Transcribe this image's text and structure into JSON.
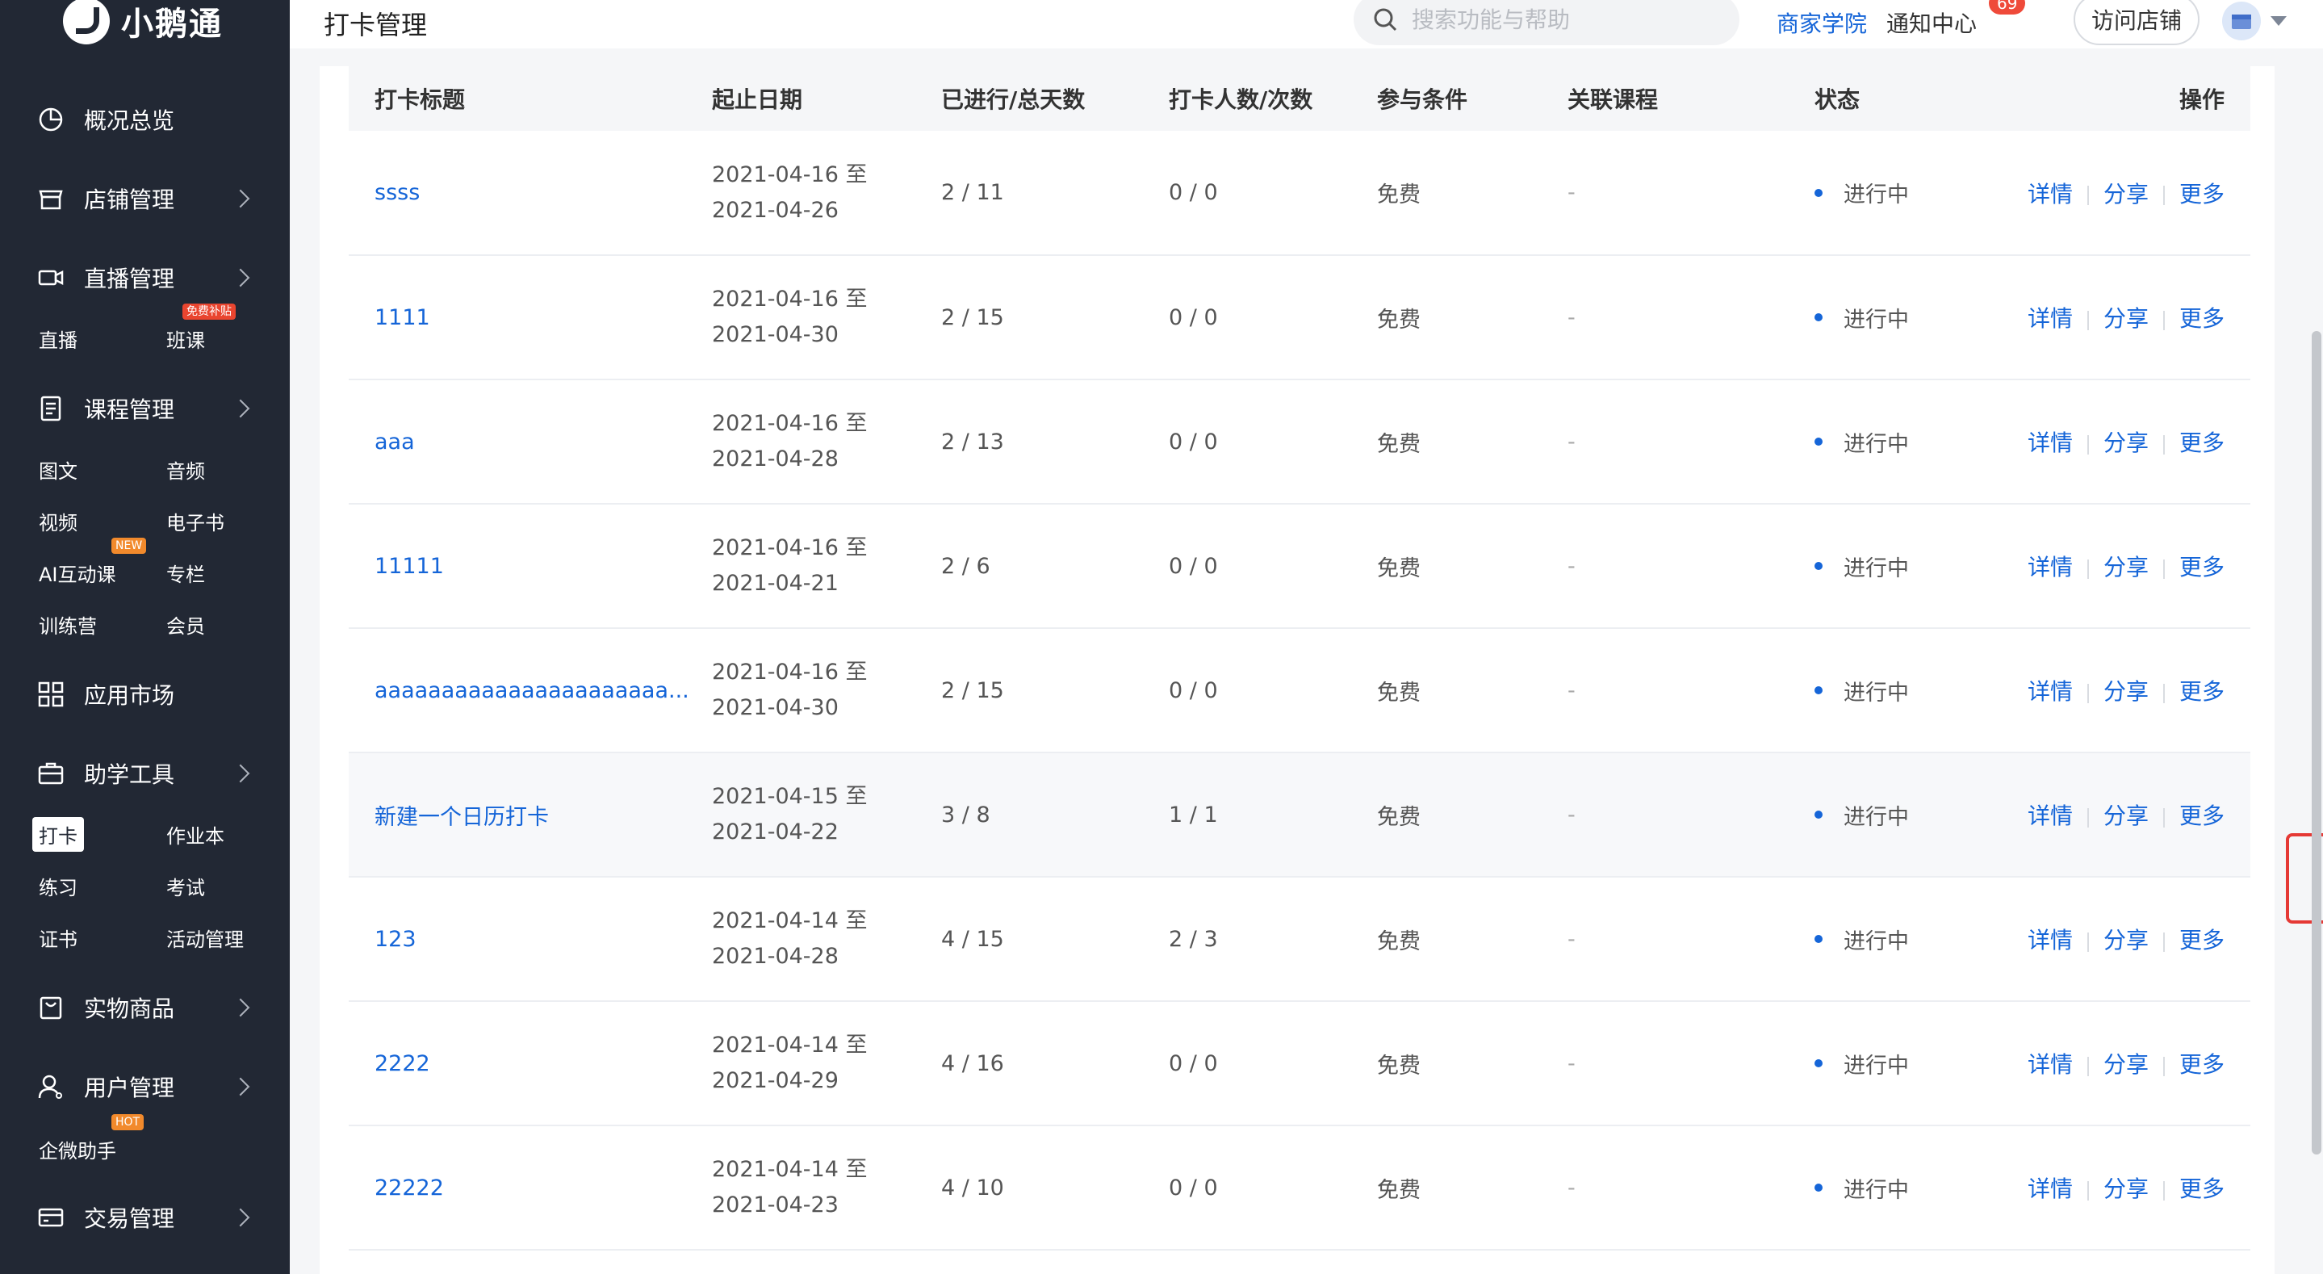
{
  "brand": {
    "name": "小鹅通"
  },
  "sidebar": {
    "groups": [
      {
        "label": "概况总览",
        "icon": "pie-chart-icon"
      },
      {
        "label": "店铺管理",
        "icon": "store-icon"
      },
      {
        "label": "直播管理",
        "icon": "camera-icon"
      },
      {
        "label": "课程管理",
        "icon": "document-icon"
      },
      {
        "label": "应用市场",
        "icon": "apps-icon"
      },
      {
        "label": "助学工具",
        "icon": "briefcase-icon"
      },
      {
        "label": "实物商品",
        "icon": "shopping-bag-icon"
      },
      {
        "label": "用户管理",
        "icon": "user-icon"
      },
      {
        "label": "交易管理",
        "icon": "card-icon"
      }
    ],
    "live": {
      "item1": "直播",
      "item2": "班课",
      "badge": "免费补贴"
    },
    "course": {
      "item1": "图文",
      "item2": "音频",
      "item3": "视频",
      "item4": "电子书",
      "item5": "AI互动课",
      "item6": "专栏",
      "item7": "训练营",
      "item8": "会员",
      "badge": "NEW"
    },
    "tools": {
      "item1": "打卡",
      "item2": "作业本",
      "item3": "练习",
      "item4": "考试",
      "item5": "证书",
      "item6": "活动管理"
    },
    "users": {
      "item1": "企微助手",
      "badge": "HOT"
    }
  },
  "header": {
    "title": "打卡管理",
    "search_placeholder": "搜索功能与帮助",
    "academy": "商家学院",
    "notifications": "通知中心",
    "notification_count": "69",
    "visit_store": "访问店铺"
  },
  "colors": {
    "accent": "#1565d8",
    "sidebar_bg": "#222834",
    "highlight_box": "#e53935"
  },
  "table": {
    "columns": [
      "打卡标题",
      "起止日期",
      "已进行/总天数",
      "打卡人数/次数",
      "参与条件",
      "关联课程",
      "状态",
      "操作"
    ],
    "actions": {
      "detail": "详情",
      "share": "分享",
      "more": "更多"
    },
    "rows": [
      {
        "title": "ssss",
        "start": "2021-04-16 至",
        "end": "2021-04-26",
        "progress": "2 / 11",
        "participants": "0 / 0",
        "condition": "免费",
        "course": "-",
        "status": "进行中"
      },
      {
        "title": "1111",
        "start": "2021-04-16 至",
        "end": "2021-04-30",
        "progress": "2 / 15",
        "participants": "0 / 0",
        "condition": "免费",
        "course": "-",
        "status": "进行中"
      },
      {
        "title": "aaa",
        "start": "2021-04-16 至",
        "end": "2021-04-28",
        "progress": "2 / 13",
        "participants": "0 / 0",
        "condition": "免费",
        "course": "-",
        "status": "进行中"
      },
      {
        "title": "11111",
        "start": "2021-04-16 至",
        "end": "2021-04-21",
        "progress": "2 / 6",
        "participants": "0 / 0",
        "condition": "免费",
        "course": "-",
        "status": "进行中"
      },
      {
        "title": "aaaaaaaaaaaaaaaaaaaaaa...",
        "start": "2021-04-16 至",
        "end": "2021-04-30",
        "progress": "2 / 15",
        "participants": "0 / 0",
        "condition": "免费",
        "course": "-",
        "status": "进行中"
      },
      {
        "title": "新建一个日历打卡",
        "start": "2021-04-15 至",
        "end": "2021-04-22",
        "progress": "3 / 8",
        "participants": "1 / 1",
        "condition": "免费",
        "course": "-",
        "status": "进行中"
      },
      {
        "title": "123",
        "start": "2021-04-14 至",
        "end": "2021-04-28",
        "progress": "4 / 15",
        "participants": "2 / 3",
        "condition": "免费",
        "course": "-",
        "status": "进行中"
      },
      {
        "title": "2222",
        "start": "2021-04-14 至",
        "end": "2021-04-29",
        "progress": "4 / 16",
        "participants": "0 / 0",
        "condition": "免费",
        "course": "-",
        "status": "进行中"
      },
      {
        "title": "22222",
        "start": "2021-04-14 至",
        "end": "2021-04-23",
        "progress": "4 / 10",
        "participants": "0 / 0",
        "condition": "免费",
        "course": "-",
        "status": "进行中"
      }
    ]
  }
}
